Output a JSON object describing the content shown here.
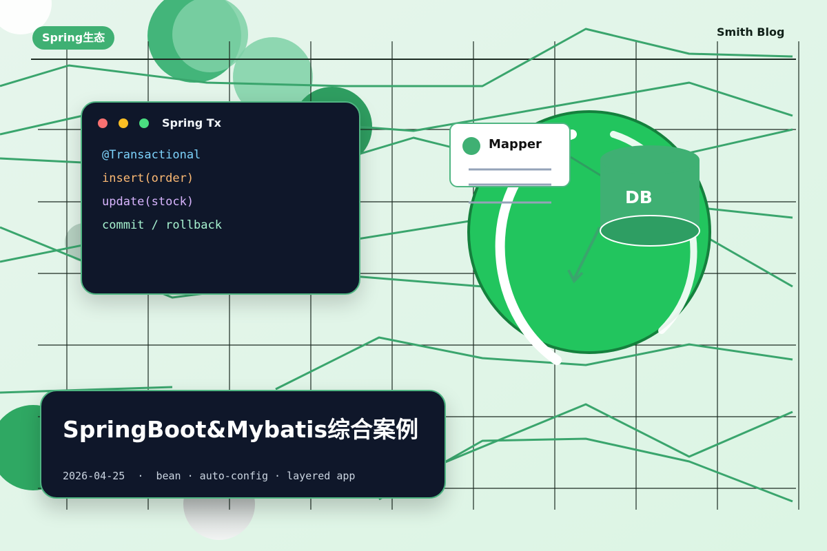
{
  "header": {
    "tag": "Spring生态",
    "blog": "Smith Blog"
  },
  "code_card": {
    "title": "Spring Tx",
    "lines": [
      "@Transactional",
      "insert(order)",
      "update(stock)",
      "commit / rollback"
    ]
  },
  "diagram": {
    "mapper_label": "Mapper",
    "db_label": "DB"
  },
  "title_card": {
    "title": "SpringBoot&Mybatis综合案例",
    "date": "2026-04-25",
    "separator": "·",
    "tags": "bean · auto-config · layered app"
  },
  "colors": {
    "accent": "#3fb073",
    "green_circle": "#22c55e",
    "card_bg": "#0f172a"
  }
}
